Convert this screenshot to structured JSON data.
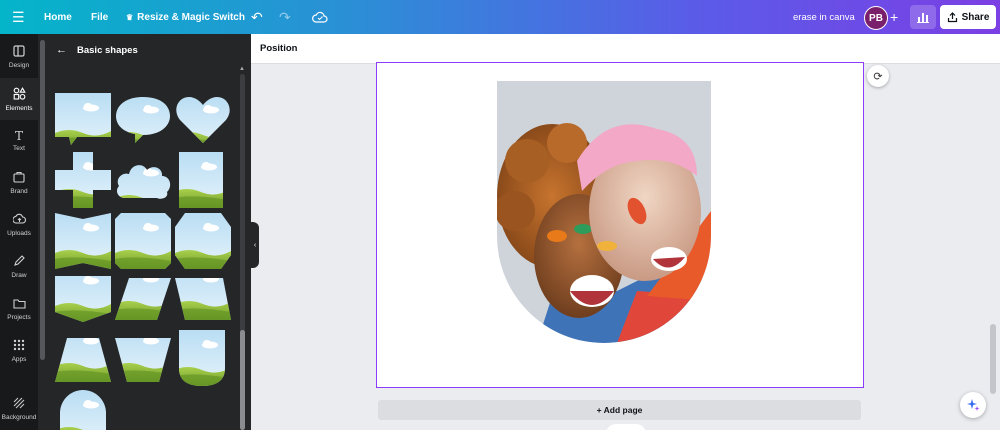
{
  "topbar": {
    "home_label": "Home",
    "file_label": "File",
    "resize_label": "Resize & Magic Switch",
    "doc_title": "erase in canva",
    "avatar_initials": "PB",
    "share_label": "Share"
  },
  "rail": {
    "items": [
      {
        "label": "Design",
        "icon": "layout-icon"
      },
      {
        "label": "Elements",
        "icon": "elements-icon"
      },
      {
        "label": "Text",
        "icon": "text-icon"
      },
      {
        "label": "Brand",
        "icon": "brand-icon"
      },
      {
        "label": "Uploads",
        "icon": "upload-icon"
      },
      {
        "label": "Draw",
        "icon": "draw-icon"
      },
      {
        "label": "Projects",
        "icon": "folder-icon"
      },
      {
        "label": "Apps",
        "icon": "apps-icon"
      },
      {
        "label": "Background",
        "icon": "background-icon"
      }
    ]
  },
  "panel": {
    "title": "Basic shapes"
  },
  "context": {
    "position_label": "Position"
  },
  "canvas": {
    "add_page_label": "+ Add page"
  },
  "colors": {
    "accent": "#8b3dff",
    "panel_bg": "#252627",
    "rail_bg": "#18191b",
    "sky": "#d6ebf8",
    "grass": "#8bbd3a"
  }
}
